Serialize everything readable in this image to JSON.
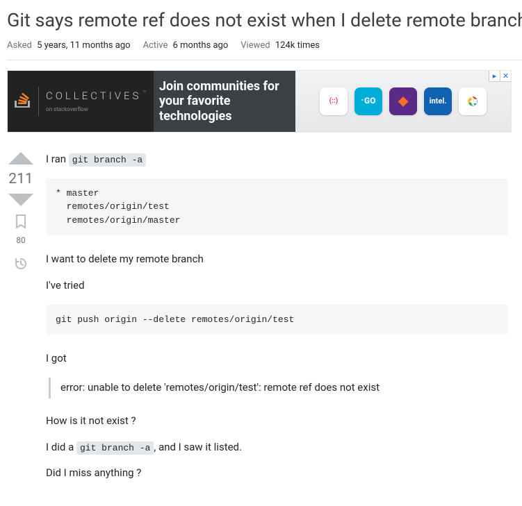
{
  "question": {
    "title": "Git says remote ref does not exist when I delete remote branch",
    "asked_label": "Asked",
    "asked_value": "5 years, 11 months ago",
    "active_label": "Active",
    "active_value": "6 months ago",
    "viewed_label": "Viewed",
    "viewed_value": "124k times"
  },
  "ad": {
    "brand_top": "COLLECTIVES",
    "brand_sub": "on stackoverflow",
    "tm": "™",
    "headline": "Join communities for your favorite technologies",
    "chips": [
      {
        "name": "twilio",
        "bg": "#ffffff",
        "fg": "#f22f46",
        "glyph": "(::)"
      },
      {
        "name": "golang",
        "bg": "#00add8",
        "fg": "#ffffff",
        "glyph": "GO"
      },
      {
        "name": "gitlab",
        "bg": "#5a2a86",
        "fg": "#fc6d26",
        "glyph": "◆"
      },
      {
        "name": "intel",
        "bg": "#0f63b0",
        "fg": "#ffffff",
        "glyph": "intel."
      },
      {
        "name": "gcloud",
        "bg": "#ffffff",
        "fg": "#4285f4",
        "glyph": "◔"
      }
    ],
    "close": "✕",
    "info": "▸"
  },
  "vote": {
    "score": "211",
    "bookmark_count": "80"
  },
  "body": {
    "p1_prefix": "I ran ",
    "p1_code": "git branch -a",
    "pre1": "* master\n  remotes/origin/test\n  remotes/origin/master",
    "p2": "I want to delete my remote branch",
    "p3": "I've tried",
    "pre2": "git push origin --delete remotes/origin/test",
    "p4": "I got",
    "quote": "error: unable to delete 'remotes/origin/test': remote ref does not exist",
    "p5": "How is it not exist ?",
    "p6_prefix": "I did a ",
    "p6_code": "git branch -a",
    "p6_suffix": ", and I saw it listed.",
    "p7": "Did I miss anything ?"
  }
}
